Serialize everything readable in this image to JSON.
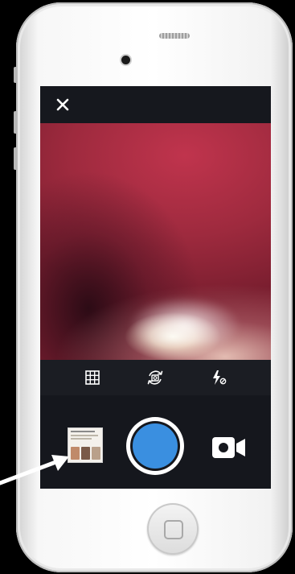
{
  "screen": {
    "close_icon": "close-icon",
    "tools": [
      "grid-icon",
      "switch-camera-icon",
      "flash-off-icon"
    ],
    "gallery_thumbnail_icon": "gallery-thumbnail-icon",
    "shutter_icon": "shutter-button",
    "video_icon": "video-camera-icon"
  },
  "colors": {
    "shutter_blue": "#3a8fe0",
    "bar_dark": "#15171d",
    "annotation_arrow": "#ffffff"
  }
}
